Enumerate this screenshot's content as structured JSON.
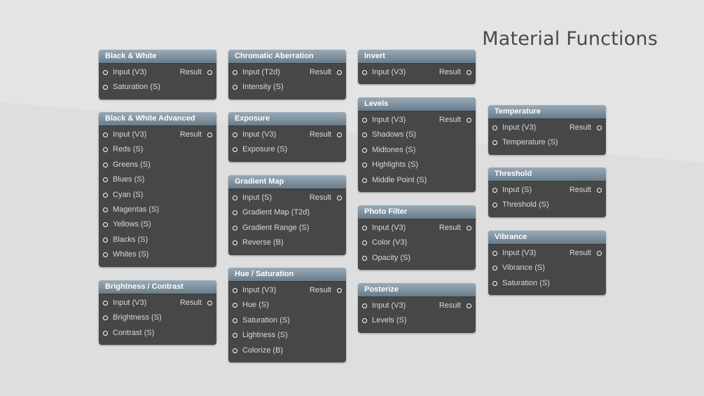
{
  "title": "Material Functions",
  "colors": {
    "background": "#e4e4e4",
    "node_body": "#474747",
    "header_top": "#98aab8",
    "header_bottom": "#6b7c89",
    "text": "#d8d8d8",
    "pin": "#ffffff"
  },
  "nodes": [
    {
      "title": "Black & White",
      "output": "Result",
      "inputs": [
        "Input (V3)",
        "Saturation (S)"
      ]
    },
    {
      "title": "Black & White Advanced",
      "output": "Result",
      "inputs": [
        "Input (V3)",
        "Reds (S)",
        "Greens (S)",
        "Blues (S)",
        "Cyan (S)",
        "Magentas (S)",
        "Yellows (S)",
        "Blacks (S)",
        "Whites (S)"
      ]
    },
    {
      "title": "Brightness / Contrast",
      "output": "Result",
      "inputs": [
        "Input (V3)",
        "Brightness (S)",
        "Contrast (S)"
      ]
    },
    {
      "title": "Chromatic Aberration",
      "output": "Result",
      "inputs": [
        "Input (T2d)",
        "Intensity (S)"
      ]
    },
    {
      "title": "Exposure",
      "output": "Result",
      "inputs": [
        "Input (V3)",
        "Exposure (S)"
      ]
    },
    {
      "title": "Gradient Map",
      "output": "Result",
      "inputs": [
        "Input (S)",
        "Gradient Map (T2d)",
        "Gradient Range (S)",
        "Reverse (B)"
      ]
    },
    {
      "title": "Hue / Saturation",
      "output": "Result",
      "inputs": [
        "Input (V3)",
        "Hue (S)",
        "Saturation (S)",
        "Lightness (S)",
        "Colorize (B)"
      ]
    },
    {
      "title": "Invert",
      "output": "Result",
      "inputs": [
        "Input (V3)"
      ]
    },
    {
      "title": "Levels",
      "output": "Result",
      "inputs": [
        "Input (V3)",
        "Shadows (S)",
        "Midtones (S)",
        "Highlights (S)",
        "Middle Point (S)"
      ]
    },
    {
      "title": "Photo Filter",
      "output": "Result",
      "inputs": [
        "Input (V3)",
        "Color (V3)",
        "Opacity (S)"
      ]
    },
    {
      "title": "Posterize",
      "output": "Result",
      "inputs": [
        "Input (V3)",
        "Levels (S)"
      ]
    },
    {
      "title": "Temperature",
      "output": "Result",
      "inputs": [
        "Input (V3)",
        "Temperature (S)"
      ]
    },
    {
      "title": "Threshold",
      "output": "Result",
      "inputs": [
        "Input (S)",
        "Threshold (S)"
      ]
    },
    {
      "title": "Vibrance",
      "output": "Result",
      "inputs": [
        "Input (V3)",
        "Vibrance (S)",
        "Saturation (S)"
      ]
    }
  ]
}
